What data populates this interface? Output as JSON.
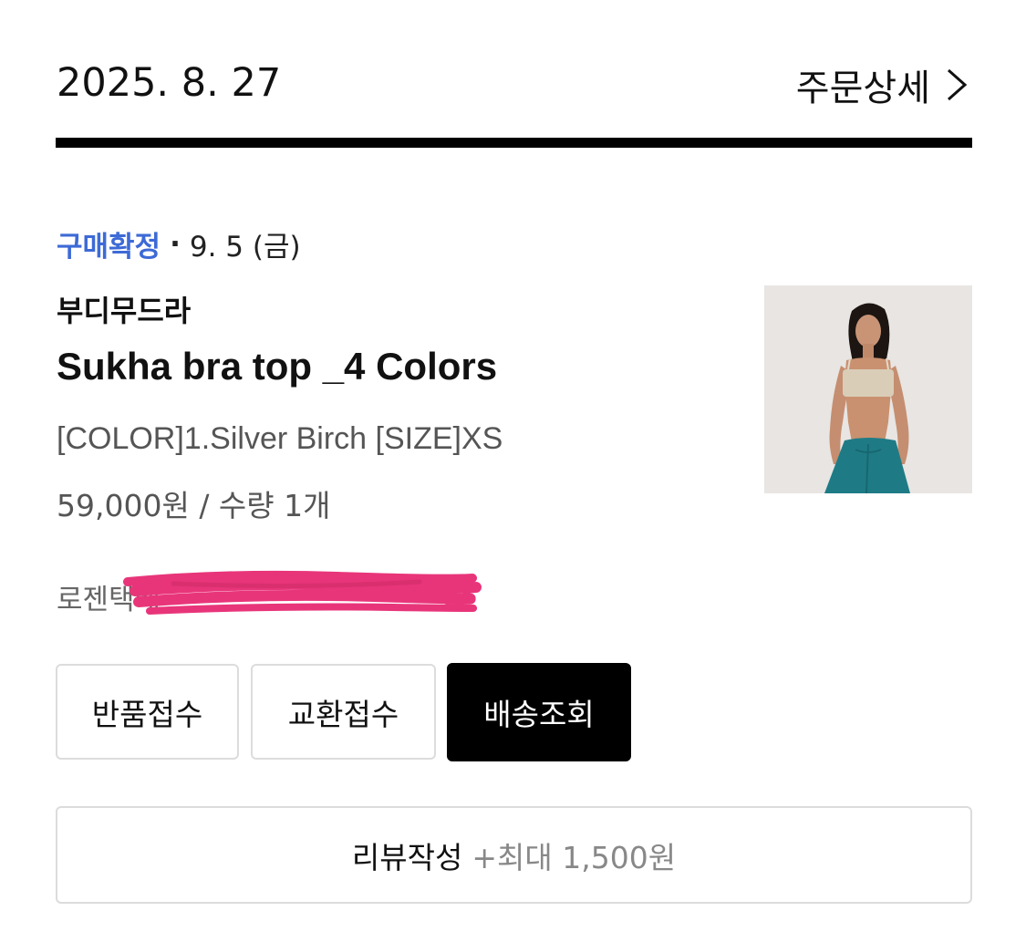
{
  "order": {
    "date": "2025. 8. 27",
    "detail_link": "주문상세"
  },
  "status": {
    "label": "구매확정",
    "separator": "·",
    "date": "9. 5 (금)"
  },
  "product": {
    "brand": "부디무드라",
    "name": "Sukha bra top _4 Colors",
    "option": "[COLOR]1.Silver Birch [SIZE]XS",
    "price_qty": "59,000원 / 수량 1개"
  },
  "shipping": {
    "carrier_prefix": "로젠택배"
  },
  "buttons": {
    "return": "반품접수",
    "exchange": "교환접수",
    "track": "배송조회",
    "review": "리뷰작성",
    "review_bonus": "+최대 1,500원"
  },
  "colors": {
    "status_blue": "#3d6ad6",
    "redaction_pink": "#e8357a",
    "divider": "#000000"
  }
}
